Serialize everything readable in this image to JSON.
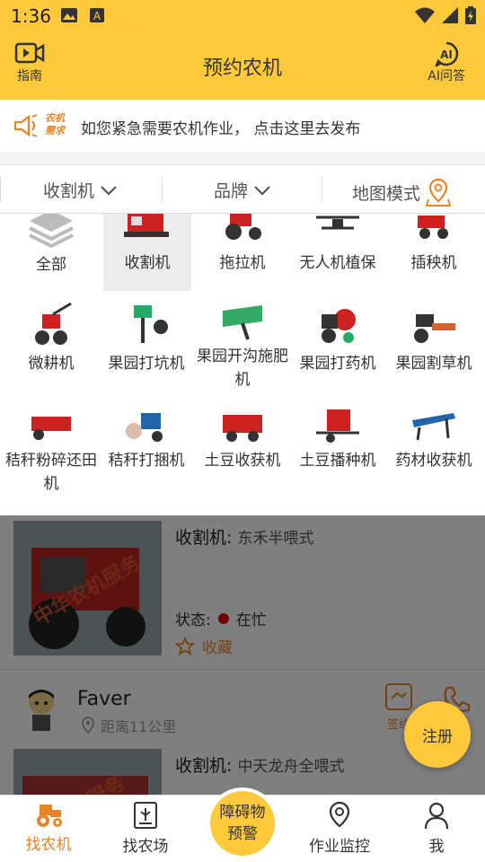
{
  "status_bar": {
    "time": "1:36"
  },
  "header": {
    "title": "预约农机",
    "left_label": "指南",
    "right_label": "AI问答"
  },
  "notice": {
    "tag_line1": "农机",
    "tag_line2": "需求",
    "text": "如您紧急需要农机作业， 点击这里去发布"
  },
  "filter": {
    "category": "收割机",
    "brand": "品牌",
    "map_mode": "地图模式"
  },
  "categories": [
    {
      "label": "全部",
      "selected": false
    },
    {
      "label": "收割机",
      "selected": true
    },
    {
      "label": "拖拉机",
      "selected": false
    },
    {
      "label": "无人机植保",
      "selected": false
    },
    {
      "label": "插秧机",
      "selected": false
    },
    {
      "label": "微耕机",
      "selected": false
    },
    {
      "label": "果园打坑机",
      "selected": false
    },
    {
      "label": "果园开沟施肥机",
      "selected": false
    },
    {
      "label": "果园打药机",
      "selected": false
    },
    {
      "label": "果园割草机",
      "selected": false
    },
    {
      "label": "秸秆粉碎还田机",
      "selected": false
    },
    {
      "label": "秸秆打捆机",
      "selected": false
    },
    {
      "label": "土豆收获机",
      "selected": false
    },
    {
      "label": "土豆播种机",
      "selected": false
    },
    {
      "label": "药材收获机",
      "selected": false
    }
  ],
  "listings": [
    {
      "title_label": "收割机:",
      "title_value": "东禾半喂式",
      "status_label": "状态:",
      "status_value": "在忙",
      "fav_label": "收藏",
      "watermark": "中华农机服务"
    },
    {
      "user": "Faver",
      "distance": "距离11公里",
      "sign_label": "签约",
      "title_label": "收割机:",
      "title_value": "中天龙舟全喂式",
      "watermark": "服务"
    }
  ],
  "fab": {
    "label": "注册"
  },
  "bottom_nav": {
    "items": [
      "找农机",
      "找农场",
      "作业监控",
      "我"
    ],
    "center_line1": "障碍物",
    "center_line2": "预警"
  },
  "colors": {
    "accent": "#FFC93C",
    "orange": "#E8862A",
    "busy": "#DD0000"
  }
}
